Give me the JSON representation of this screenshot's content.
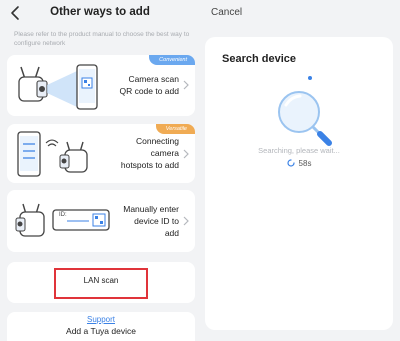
{
  "left": {
    "title": "Other ways to add",
    "intro": "Please refer to the product manual to choose the best way to configure network",
    "options": [
      {
        "line1": "Camera scan",
        "line2": "QR code to add",
        "tag": "Convenient"
      },
      {
        "line1": "Connecting",
        "line2": "camera",
        "line3": "hotspots to add",
        "tag": "Versatile"
      },
      {
        "line1": "Manually enter",
        "line2": "device ID to",
        "line3": "add",
        "device_id_text": "ID:"
      }
    ],
    "lan_scan": "LAN scan",
    "support_link": "Support",
    "add_tuya": "Add a Tuya device"
  },
  "right": {
    "cancel": "Cancel",
    "title": "Search device",
    "searching": "Searching, please wait...",
    "countdown": "58s"
  },
  "colors": {
    "accent_blue": "#3b82e6",
    "tag_blue": "#6ba8ef",
    "tag_orange": "#f0ab54",
    "highlight_red": "#e0343a"
  }
}
